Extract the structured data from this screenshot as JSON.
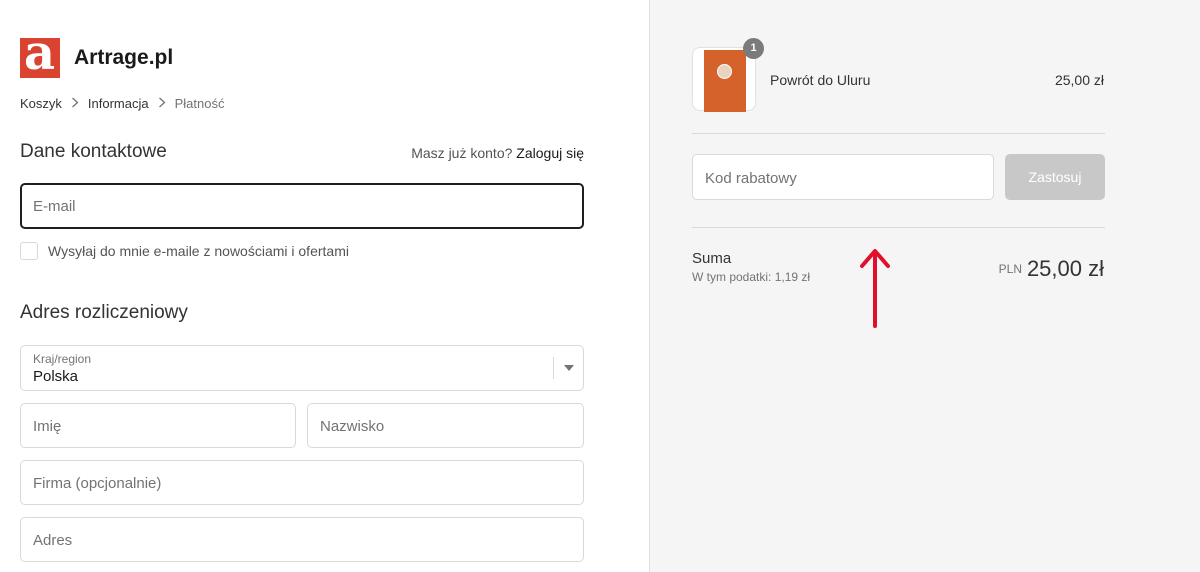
{
  "brand": {
    "logo_letter": "a",
    "name": "Artrage.pl",
    "logo_color": "#d9432f"
  },
  "breadcrumb": [
    {
      "label": "Koszyk"
    },
    {
      "label": "Informacja"
    },
    {
      "label": "Płatność"
    }
  ],
  "contact": {
    "title": "Dane kontaktowe",
    "login_prompt": "Masz już konto?",
    "login_link": "Zaloguj się",
    "email_placeholder": "E-mail",
    "newsletter_label": "Wysyłaj do mnie e-maile z nowościami i ofertami"
  },
  "billing": {
    "title": "Adres rozliczeniowy",
    "country_label": "Kraj/region",
    "country_value": "Polska",
    "first_name_placeholder": "Imię",
    "last_name_placeholder": "Nazwisko",
    "company_placeholder": "Firma (opcjonalnie)",
    "address_placeholder": "Adres"
  },
  "order": {
    "product": {
      "name": "Powrót do Uluru",
      "price": "25,00 zł",
      "quantity": "1"
    },
    "discount_placeholder": "Kod rabatowy",
    "apply_label": "Zastosuj",
    "sum_label": "Suma",
    "tax_label": "W tym podatki: 1,19 zł",
    "currency": "PLN",
    "total": "25,00 zł"
  },
  "colors": {
    "annotation_arrow": "#e0102a",
    "panel_bg": "#f5f5f5"
  }
}
